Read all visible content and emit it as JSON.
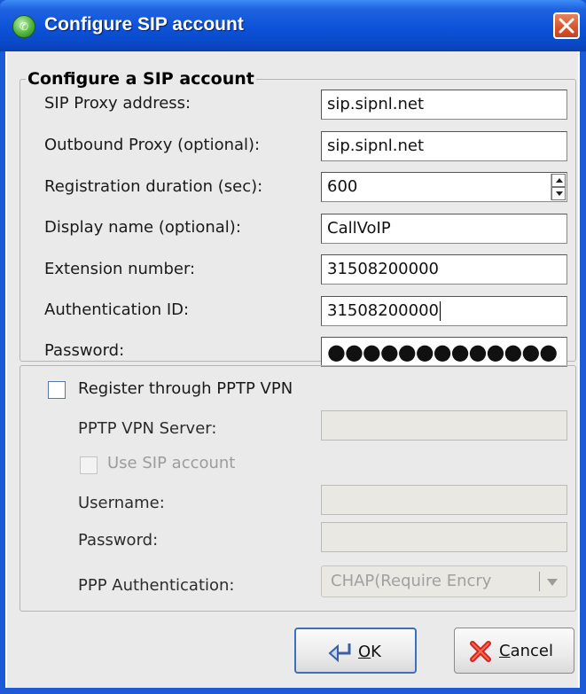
{
  "window": {
    "title": "Configure SIP account",
    "app_icon": "callvoip-icon",
    "close_icon": "close-icon"
  },
  "sip_group": {
    "legend": "Configure a SIP account",
    "proxy_label": "SIP Proxy address:",
    "proxy_value": "sip.sipnl.net",
    "outbound_label": "Outbound Proxy (optional):",
    "outbound_value": "sip.sipnl.net",
    "duration_label": "Registration duration (sec):",
    "duration_value": "600",
    "display_label": "Display name (optional):",
    "display_value": "CallVoIP",
    "extension_label": "Extension number:",
    "extension_value": "31508200000",
    "auth_id_label": "Authentication ID:",
    "auth_id_value": "31508200000",
    "password_label": "Password:",
    "password_mask": "●●●●●●●●●●●●●"
  },
  "vpn_group": {
    "register_label": "Register through PPTP VPN",
    "register_checked": false,
    "server_label": "PPTP VPN Server:",
    "use_sip_label": "Use SIP account",
    "username_label": "Username:",
    "password_label": "Password:",
    "ppp_auth_label": "PPP Authentication:",
    "ppp_auth_value": "CHAP(Require Encry"
  },
  "buttons": {
    "ok_label": "OK",
    "cancel_label": "Cancel"
  },
  "colors": {
    "titlebar": "#0c52d9",
    "frame": "#1d5ad8",
    "close": "#d5542c",
    "panel": "#eaeaea"
  }
}
